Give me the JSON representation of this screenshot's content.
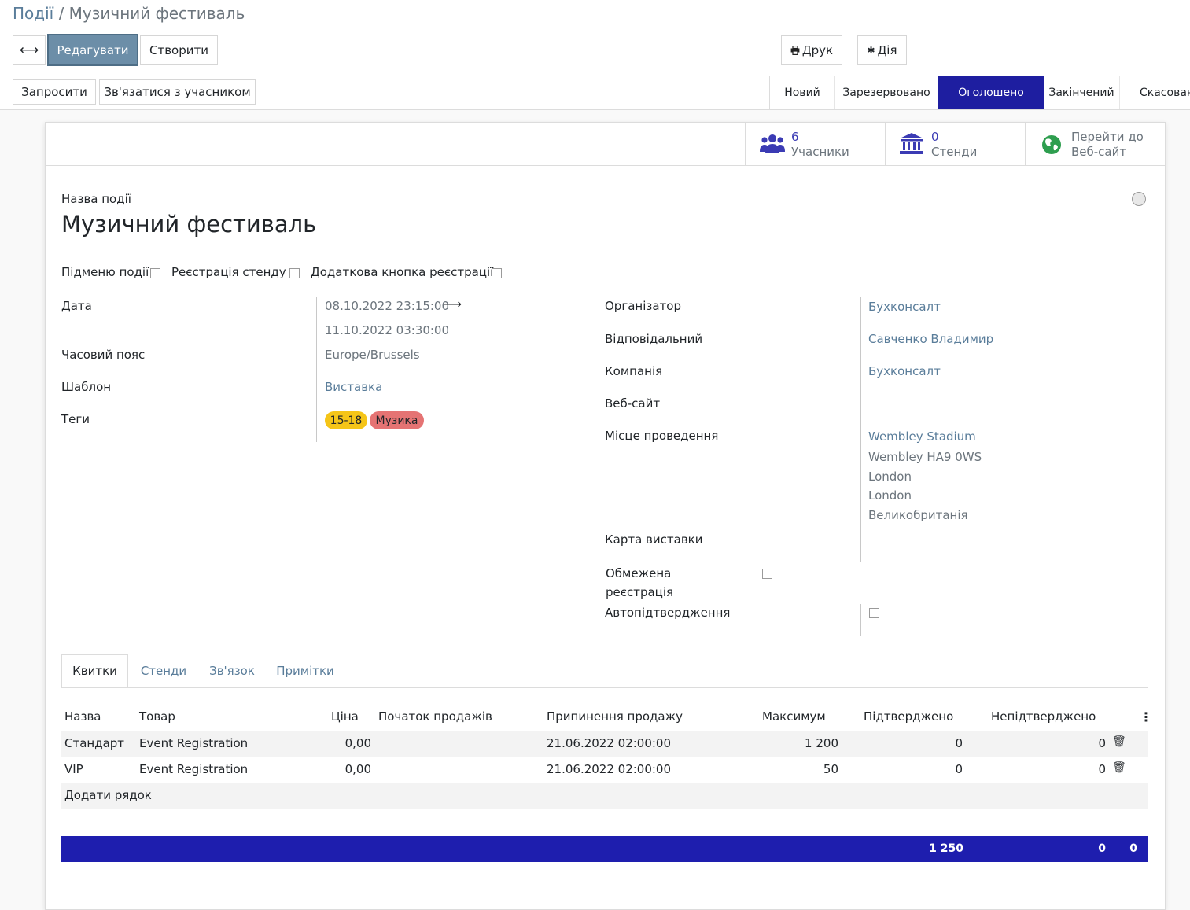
{
  "breadcrumb": {
    "parent": "Події",
    "separator": " / ",
    "current": "Музичний фестиваль"
  },
  "toolbar": {
    "toggle_icon": "⟷",
    "edit_label": "Редагувати",
    "create_label": "Створити",
    "print_icon": "print-icon",
    "print_label": "Друк",
    "action_icon": "gear-icon",
    "action_label": "Дія"
  },
  "statusbar": {
    "invite_label": "Запросити",
    "contact_label": "Зв'язатися з учасником",
    "stages": [
      "Новий",
      "Зарезервовано",
      "Оголошено",
      "Закінчений",
      "Скасован"
    ],
    "active_stage": "Оголошено"
  },
  "smart_buttons": [
    {
      "icon": "users-icon",
      "value": "6",
      "label": "Учасники"
    },
    {
      "icon": "building-icon",
      "value": "0",
      "label": "Стенди"
    },
    {
      "icon": "globe-icon",
      "value": "Перейти до",
      "label": "Веб-сайт"
    }
  ],
  "event": {
    "name_label": "Назва події",
    "name": "Музичний фестиваль"
  },
  "options": {
    "submenu_label": "Підменю події",
    "booth_label": "Реєстрація стенду",
    "extra_button_label": "Додаткова кнопка реєстрації"
  },
  "left_fields": {
    "date_label": "Дата",
    "date_start": "08.10.2022 23:15:00",
    "date_end": "11.10.2022 03:30:00",
    "timezone_label": "Часовий пояс",
    "timezone": "Europe/Brussels",
    "template_label": "Шаблон",
    "template": "Виставка",
    "tags_label": "Теги",
    "tags": [
      {
        "name": "15-18",
        "color": "#f5c518"
      },
      {
        "name": "Музика",
        "color": "#e57373"
      }
    ]
  },
  "right_fields": {
    "organizer_label": "Організатор",
    "organizer": "Бухконсалт",
    "responsible_label": "Відповідальний",
    "responsible": "Савченко Владимир",
    "company_label": "Компанія",
    "company": "Бухконсалт",
    "website_label": "Веб-сайт",
    "venue_label": "Місце проведення",
    "venue_lines": [
      "Wembley Stadium",
      "Wembley HA9 0WS",
      "London",
      "London",
      "Великобританія"
    ],
    "map_label": "Карта виставки",
    "limited_label_1": "Обмежена",
    "limited_label_2": "реєстрація",
    "autoconfirm_label": "Автопідтвердження"
  },
  "tabs": [
    "Квитки",
    "Стенди",
    "Зв'язок",
    "Примітки"
  ],
  "tickets": {
    "headers": [
      "Назва",
      "Товар",
      "Ціна",
      "Початок продажів",
      "Припинення продажу",
      "Максимум",
      "Підтверджено",
      "Непідтверджено"
    ],
    "rows": [
      {
        "name": "Стандарт",
        "product": "Event Registration",
        "price": "0,00",
        "start": "",
        "end": "21.06.2022 02:00:00",
        "max": "1 200",
        "confirmed": "0",
        "unconfirmed": "0"
      },
      {
        "name": "VIP",
        "product": "Event Registration",
        "price": "0,00",
        "start": "",
        "end": "21.06.2022 02:00:00",
        "max": "50",
        "confirmed": "0",
        "unconfirmed": "0"
      }
    ],
    "add_line_label": "Додати рядок",
    "totals": {
      "max": "1 250",
      "confirmed": "0",
      "unconfirmed": "0"
    }
  }
}
